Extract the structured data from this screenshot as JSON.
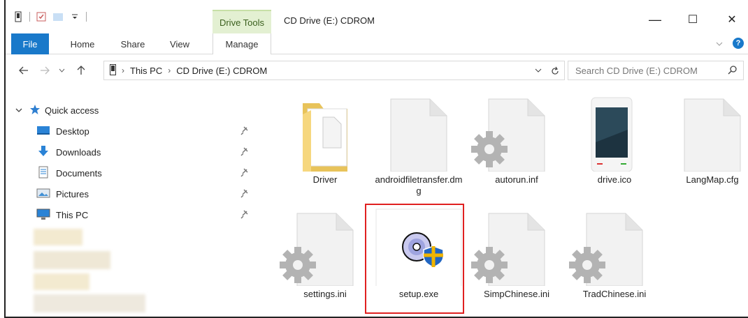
{
  "window": {
    "title": "CD Drive (E:) CDROM",
    "context_tab_group": "Drive Tools",
    "controls": {
      "minimize": "—",
      "maximize": "☐",
      "close": "✕"
    }
  },
  "ribbon": {
    "tabs": [
      {
        "label": "File"
      },
      {
        "label": "Home"
      },
      {
        "label": "Share"
      },
      {
        "label": "View"
      },
      {
        "label": "Manage"
      }
    ],
    "help": "?"
  },
  "navigation": {
    "breadcrumb": [
      "This PC",
      "CD Drive (E:) CDROM"
    ],
    "search_placeholder": "Search CD Drive (E:) CDROM"
  },
  "sidebar": {
    "quick_access": "Quick access",
    "items": [
      {
        "label": "Desktop",
        "icon": "desktop-icon",
        "pinned": true
      },
      {
        "label": "Downloads",
        "icon": "download-icon",
        "pinned": true
      },
      {
        "label": "Documents",
        "icon": "documents-icon",
        "pinned": true
      },
      {
        "label": "Pictures",
        "icon": "pictures-icon",
        "pinned": true
      },
      {
        "label": "This PC",
        "icon": "computer-icon",
        "pinned": true
      }
    ]
  },
  "files": [
    {
      "name": "Driver",
      "icon": "folder-icon"
    },
    {
      "name": "androidfiletransfer.dmg",
      "icon": "blank-file-icon"
    },
    {
      "name": "autorun.inf",
      "icon": "settings-file-icon"
    },
    {
      "name": "drive.ico",
      "icon": "phone-icon"
    },
    {
      "name": "LangMap.cfg",
      "icon": "blank-file-icon"
    },
    {
      "name": "settings.ini",
      "icon": "settings-file-icon"
    },
    {
      "name": "setup.exe",
      "icon": "setup-disc-icon",
      "selected": true
    },
    {
      "name": "SimpChinese.ini",
      "icon": "settings-file-icon"
    },
    {
      "name": "TradChinese.ini",
      "icon": "settings-file-icon"
    }
  ],
  "colors": {
    "accent": "#1979ca",
    "highlight": "#e02020",
    "drive_tools": "#e3f0d2"
  }
}
